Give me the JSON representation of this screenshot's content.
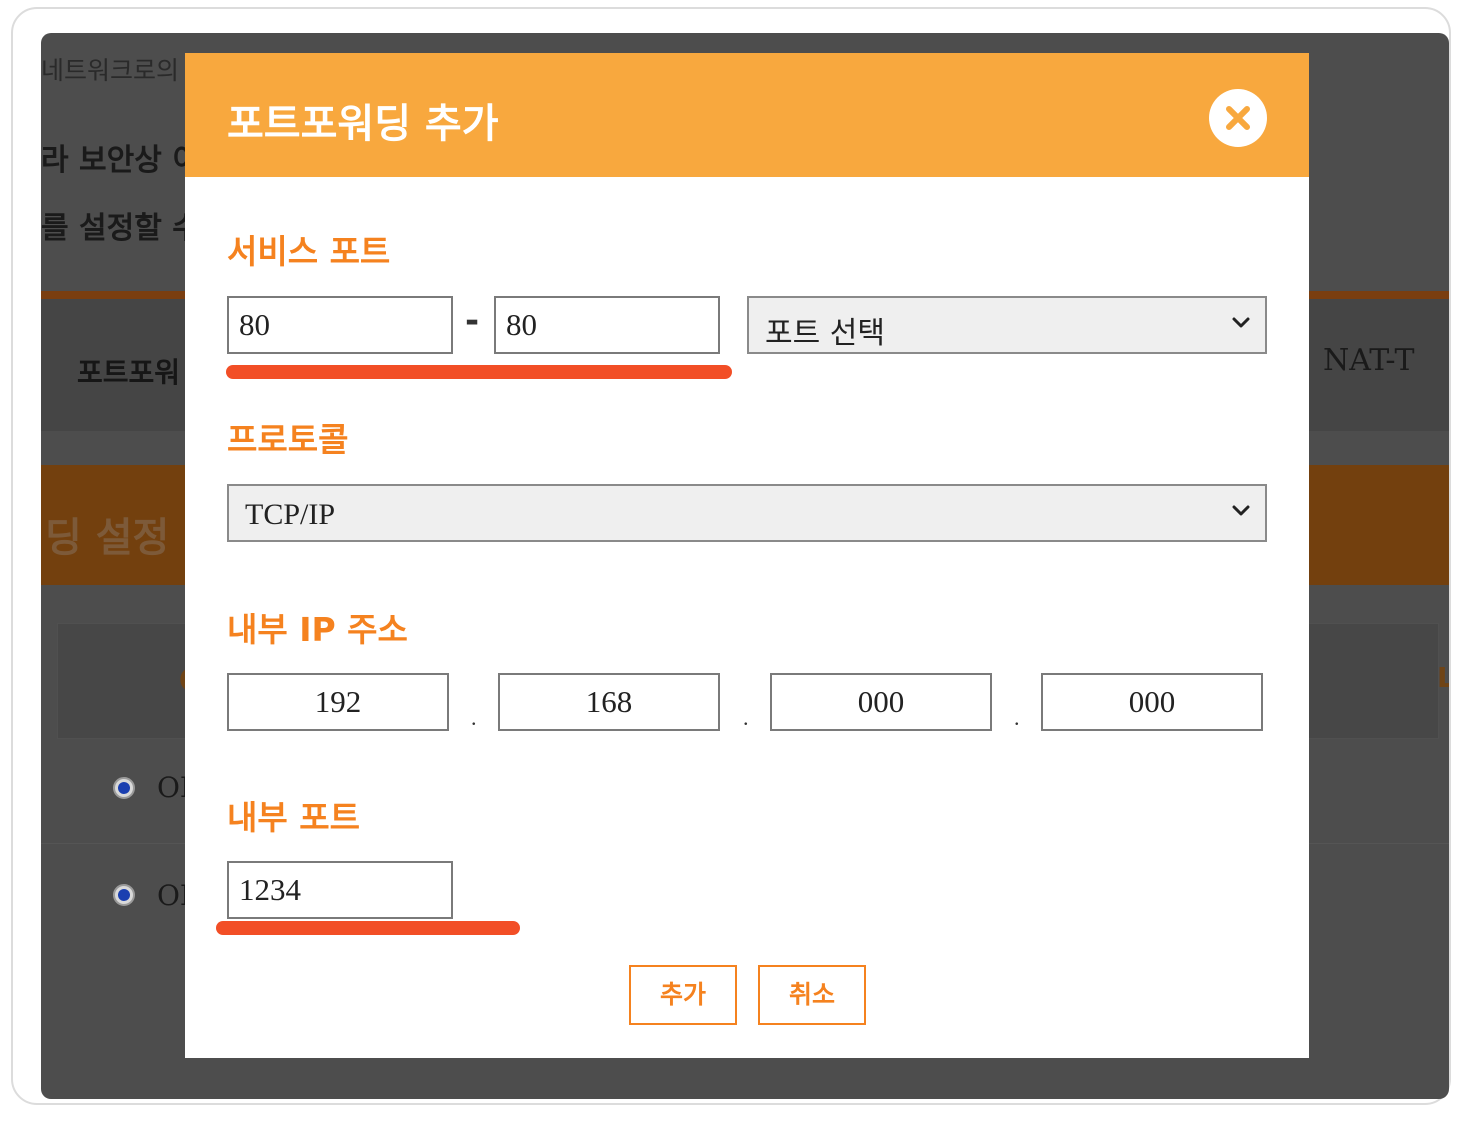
{
  "background": {
    "intro_line1": "네트워크로의 접속이 가능하도록 설정할 수 있습니다",
    "intro_line2": "라 보안상 이",
    "intro_line3": "를 설정할 수",
    "tab_port_forwarding": "포트포워",
    "tab_nat": "NAT-T",
    "section_title": "딩 설정",
    "col_c": "C",
    "col_l": "L",
    "row1_radio": "ON",
    "row2_radio": "ON"
  },
  "modal": {
    "title": "포트포워딩 추가",
    "service_port": {
      "label": "서비스 포트",
      "start": "80",
      "separator": "-",
      "end": "80",
      "select_value": "포트 선택"
    },
    "protocol": {
      "label": "프로토콜",
      "select_value": "TCP/IP"
    },
    "internal_ip": {
      "label": "내부 IP 주소",
      "octets": [
        "192",
        "168",
        "000",
        "000"
      ],
      "separator": "."
    },
    "internal_port": {
      "label": "내부 포트",
      "value": "1234"
    },
    "buttons": {
      "add": "추가",
      "cancel": "취소"
    }
  },
  "colors": {
    "header": "#f8a83e",
    "label": "#f5821f",
    "highlight": "#f24e26",
    "overlay": "#4d4d4d"
  },
  "icons": [
    "close-icon",
    "chevron-down-icon"
  ]
}
